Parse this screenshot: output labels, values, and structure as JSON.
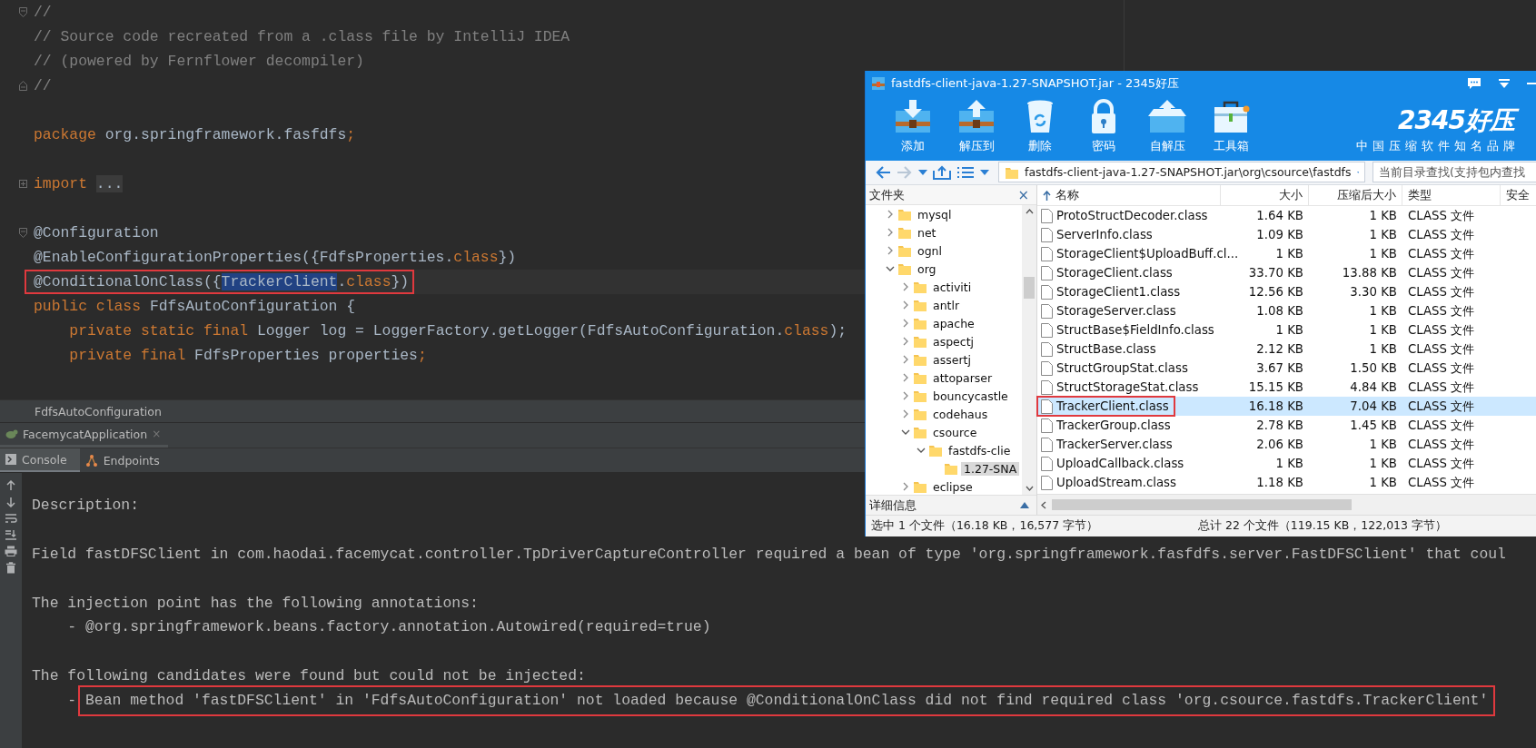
{
  "editor": {
    "lines": [
      {
        "kind": "code",
        "marker": {
          "kind": "fold-open"
        },
        "current": false,
        "boxed": false,
        "tokens": [
          {
            "text": "//",
            "kind": "comment"
          }
        ]
      },
      {
        "kind": "code",
        "current": false,
        "boxed": false,
        "tokens": [
          {
            "text": "// Source code recreated from a .class file by IntelliJ IDEA",
            "kind": "comment"
          }
        ]
      },
      {
        "kind": "code",
        "current": false,
        "boxed": false,
        "tokens": [
          {
            "text": "// (powered by Fernflower decompiler)",
            "kind": "comment"
          }
        ]
      },
      {
        "kind": "code",
        "marker": {
          "kind": "fold-close"
        },
        "current": false,
        "boxed": false,
        "tokens": [
          {
            "text": "//",
            "kind": "comment"
          }
        ]
      },
      {
        "kind": "blank"
      },
      {
        "kind": "code",
        "current": false,
        "boxed": false,
        "tokens": [
          {
            "text": "package",
            "kind": "keyword"
          },
          {
            "text": " org.springframework.fasfdfs",
            "kind": "plain"
          },
          {
            "text": ";",
            "kind": "keyword"
          }
        ]
      },
      {
        "kind": "blank"
      },
      {
        "kind": "code",
        "marker": {
          "kind": "expand"
        },
        "current": false,
        "boxed": false,
        "tokens": [
          {
            "text": "import ",
            "kind": "keyword"
          },
          {
            "text": "...",
            "kind": "folded"
          }
        ]
      },
      {
        "kind": "blank"
      },
      {
        "kind": "code",
        "marker": {
          "kind": "fold-open"
        },
        "current": false,
        "boxed": false,
        "tokens": [
          {
            "text": "@Configuration",
            "kind": "plain"
          }
        ]
      },
      {
        "kind": "code",
        "current": false,
        "boxed": false,
        "tokens": [
          {
            "text": "@EnableConfigurationProperties({FdfsProperties.",
            "kind": "plain"
          },
          {
            "text": "class",
            "kind": "keyword"
          },
          {
            "text": "})",
            "kind": "plain"
          }
        ]
      },
      {
        "kind": "code",
        "current": true,
        "boxed": true,
        "tokens": [
          {
            "text": "@ConditionalOnClass({",
            "kind": "plain"
          },
          {
            "text": "TrackerClient",
            "kind": "selected"
          },
          {
            "text": ".",
            "kind": "plain"
          },
          {
            "text": "class",
            "kind": "keyword"
          },
          {
            "text": "})",
            "kind": "plain"
          }
        ]
      },
      {
        "kind": "code",
        "current": false,
        "boxed": false,
        "tokens": [
          {
            "text": "public class",
            "kind": "keyword"
          },
          {
            "text": " FdfsAutoConfiguration {",
            "kind": "plain"
          }
        ]
      },
      {
        "kind": "code",
        "current": false,
        "boxed": false,
        "tokens": [
          {
            "text": "    private static final",
            "kind": "keyword"
          },
          {
            "text": " Logger log = LoggerFactory.getLogger(FdfsAutoConfiguration.",
            "kind": "plain"
          },
          {
            "text": "class",
            "kind": "keyword"
          },
          {
            "text": ");",
            "kind": "plain"
          }
        ]
      },
      {
        "kind": "code",
        "current": false,
        "boxed": false,
        "tokens": [
          {
            "text": "    private final",
            "kind": "keyword"
          },
          {
            "text": " FdfsProperties properties",
            "kind": "plain"
          },
          {
            "text": ";",
            "kind": "keyword"
          }
        ]
      }
    ],
    "breadcrumb": "FdfsAutoConfiguration"
  },
  "run_tab": {
    "label": "FacemycatApplication",
    "close": "×"
  },
  "console_tabs": [
    {
      "label": "Console",
      "selected": true
    },
    {
      "label": "Endpoints",
      "selected": false
    }
  ],
  "console": {
    "lines": [
      {
        "kind": "text",
        "tokens": [
          {
            "text": "Description:",
            "boxed": false
          }
        ]
      },
      {
        "kind": "blank"
      },
      {
        "kind": "text",
        "tokens": [
          {
            "text": "Field fastDFSClient in com.haodai.facemycat.controller.TpDriverCaptureController required a bean of type 'org.springframework.fasfdfs.server.FastDFSClient' that coul",
            "boxed": false
          }
        ]
      },
      {
        "kind": "blank"
      },
      {
        "kind": "text",
        "tokens": [
          {
            "text": "The injection point has the following annotations:",
            "boxed": false
          }
        ]
      },
      {
        "kind": "text",
        "tokens": [
          {
            "text": "    - @org.springframework.beans.factory.annotation.Autowired(required=true)",
            "boxed": false
          }
        ]
      },
      {
        "kind": "blank"
      },
      {
        "kind": "text",
        "tokens": [
          {
            "text": "The following candidates were found but could not be injected:",
            "boxed": false
          }
        ]
      },
      {
        "kind": "text",
        "tokens": [
          {
            "text": "    - ",
            "boxed": false
          },
          {
            "text": "Bean method 'fastDFSClient' in 'FdfsAutoConfiguration' not loaded because @ConditionalOnClass did not find required class 'org.csource.fastdfs.TrackerClient'",
            "boxed": true
          }
        ]
      }
    ]
  },
  "archive_window": {
    "title": "fastdfs-client-java-1.27-SNAPSHOT.jar - 2345好压",
    "toolbar": [
      {
        "label": "添加"
      },
      {
        "label": "解压到"
      },
      {
        "label": "删除"
      },
      {
        "label": "密码"
      },
      {
        "label": "自解压"
      },
      {
        "label": "工具箱"
      }
    ],
    "logo": "2345好压",
    "slogan": "中国压缩软件知名品牌",
    "address": "fastdfs-client-java-1.27-SNAPSHOT.jar\\org\\csource\\fastdfs",
    "search": {
      "placeholder": "当前目录查找(支持包内查找"
    },
    "folder_pane": {
      "title": "文件夹",
      "close": "×",
      "details": "详细信息",
      "tree": [
        {
          "label": "mysql",
          "expandable": true,
          "expanded": false,
          "selected": false
        },
        {
          "label": "net",
          "expandable": true,
          "expanded": false,
          "selected": false
        },
        {
          "label": "ognl",
          "expandable": true,
          "expanded": false,
          "selected": false
        },
        {
          "label": "org",
          "expandable": true,
          "expanded": true,
          "selected": false,
          "children": [
            {
              "label": "activiti",
              "expandable": true,
              "expanded": false,
              "selected": false
            },
            {
              "label": "antlr",
              "expandable": true,
              "expanded": false,
              "selected": false
            },
            {
              "label": "apache",
              "expandable": true,
              "expanded": false,
              "selected": false
            },
            {
              "label": "aspectj",
              "expandable": true,
              "expanded": false,
              "selected": false
            },
            {
              "label": "assertj",
              "expandable": true,
              "expanded": false,
              "selected": false
            },
            {
              "label": "attoparser",
              "expandable": true,
              "expanded": false,
              "selected": false
            },
            {
              "label": "bouncycastle",
              "expandable": true,
              "expanded": false,
              "selected": false
            },
            {
              "label": "codehaus",
              "expandable": true,
              "expanded": false,
              "selected": false
            },
            {
              "label": "csource",
              "expandable": true,
              "expanded": true,
              "selected": false,
              "children": [
                {
                  "label": "fastdfs-clie",
                  "expandable": true,
                  "expanded": true,
                  "selected": false,
                  "children": [
                    {
                      "label": "1.27-SNA",
                      "expandable": false,
                      "expanded": false,
                      "selected": true
                    }
                  ]
                }
              ]
            },
            {
              "label": "eclipse",
              "expandable": true,
              "expanded": false,
              "selected": false
            }
          ]
        }
      ]
    },
    "columns": [
      "名称",
      "大小",
      "压缩后大小",
      "类型",
      "安全"
    ],
    "files": [
      {
        "name": "ProtoStructDecoder.class",
        "size": "1.64 KB",
        "packed": "1 KB",
        "type": "CLASS 文件",
        "selected": false,
        "marked": false
      },
      {
        "name": "ServerInfo.class",
        "size": "1.09 KB",
        "packed": "1 KB",
        "type": "CLASS 文件",
        "selected": false,
        "marked": false
      },
      {
        "name": "StorageClient$UploadBuff.cl...",
        "size": "1 KB",
        "packed": "1 KB",
        "type": "CLASS 文件",
        "selected": false,
        "marked": false
      },
      {
        "name": "StorageClient.class",
        "size": "33.70 KB",
        "packed": "13.88 KB",
        "type": "CLASS 文件",
        "selected": false,
        "marked": false
      },
      {
        "name": "StorageClient1.class",
        "size": "12.56 KB",
        "packed": "3.30 KB",
        "type": "CLASS 文件",
        "selected": false,
        "marked": false
      },
      {
        "name": "StorageServer.class",
        "size": "1.08 KB",
        "packed": "1 KB",
        "type": "CLASS 文件",
        "selected": false,
        "marked": false
      },
      {
        "name": "StructBase$FieldInfo.class",
        "size": "1 KB",
        "packed": "1 KB",
        "type": "CLASS 文件",
        "selected": false,
        "marked": false
      },
      {
        "name": "StructBase.class",
        "size": "2.12 KB",
        "packed": "1 KB",
        "type": "CLASS 文件",
        "selected": false,
        "marked": false
      },
      {
        "name": "StructGroupStat.class",
        "size": "3.67 KB",
        "packed": "1.50 KB",
        "type": "CLASS 文件",
        "selected": false,
        "marked": false
      },
      {
        "name": "StructStorageStat.class",
        "size": "15.15 KB",
        "packed": "4.84 KB",
        "type": "CLASS 文件",
        "selected": false,
        "marked": false
      },
      {
        "name": "TrackerClient.class",
        "size": "16.18 KB",
        "packed": "7.04 KB",
        "type": "CLASS 文件",
        "selected": true,
        "marked": true
      },
      {
        "name": "TrackerGroup.class",
        "size": "2.78 KB",
        "packed": "1.45 KB",
        "type": "CLASS 文件",
        "selected": false,
        "marked": false
      },
      {
        "name": "TrackerServer.class",
        "size": "2.06 KB",
        "packed": "1 KB",
        "type": "CLASS 文件",
        "selected": false,
        "marked": false
      },
      {
        "name": "UploadCallback.class",
        "size": "1 KB",
        "packed": "1 KB",
        "type": "CLASS 文件",
        "selected": false,
        "marked": false
      },
      {
        "name": "UploadStream.class",
        "size": "1.18 KB",
        "packed": "1 KB",
        "type": "CLASS 文件",
        "selected": false,
        "marked": false
      }
    ],
    "status_left": "选中 1 个文件（16.18 KB，16,577 字节）",
    "status_right": "总计 22 个文件（119.15 KB，122,013 字节）"
  }
}
